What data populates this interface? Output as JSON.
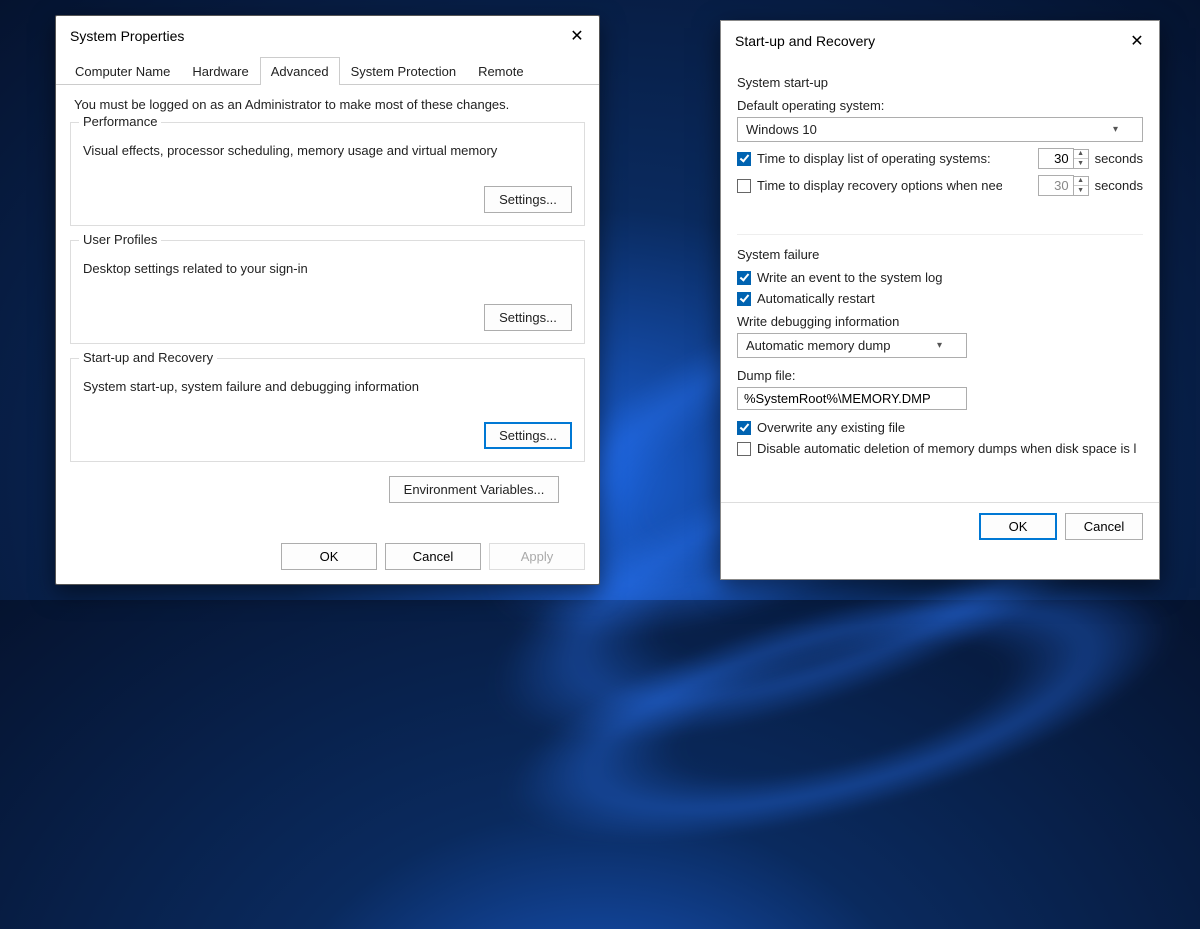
{
  "system_properties": {
    "title": "System Properties",
    "tabs": [
      "Computer Name",
      "Hardware",
      "Advanced",
      "System Protection",
      "Remote"
    ],
    "active_tab": 2,
    "instruction": "You must be logged on as an Administrator to make most of these changes.",
    "groups": {
      "performance": {
        "title": "Performance",
        "desc": "Visual effects, processor scheduling, memory usage and virtual memory",
        "button": "Settings..."
      },
      "user_profiles": {
        "title": "User Profiles",
        "desc": "Desktop settings related to your sign-in",
        "button": "Settings..."
      },
      "startup_recovery": {
        "title": "Start-up and Recovery",
        "desc": "System start-up, system failure and debugging information",
        "button": "Settings..."
      }
    },
    "env_button": "Environment Variables...",
    "footer": {
      "ok": "OK",
      "cancel": "Cancel",
      "apply": "Apply"
    }
  },
  "startup_recovery": {
    "title": "Start-up and Recovery",
    "startup": {
      "section": "System start-up",
      "default_os_label": "Default operating system:",
      "default_os_value": "Windows 10",
      "time_list_label": "Time to display list of operating systems:",
      "time_list_checked": true,
      "time_list_value": "30",
      "time_recovery_label": "Time to display recovery options when needed:",
      "time_recovery_checked": false,
      "time_recovery_value": "30",
      "seconds": "seconds"
    },
    "failure": {
      "section": "System failure",
      "write_event_label": "Write an event to the system log",
      "write_event_checked": true,
      "auto_restart_label": "Automatically restart",
      "auto_restart_checked": true,
      "debug_label": "Write debugging information",
      "debug_value": "Automatic memory dump",
      "dump_label": "Dump file:",
      "dump_value": "%SystemRoot%\\MEMORY.DMP",
      "overwrite_label": "Overwrite any existing file",
      "overwrite_checked": true,
      "disable_auto_del_label": "Disable automatic deletion of memory dumps when disk space is l",
      "disable_auto_del_checked": false
    },
    "footer": {
      "ok": "OK",
      "cancel": "Cancel"
    }
  }
}
